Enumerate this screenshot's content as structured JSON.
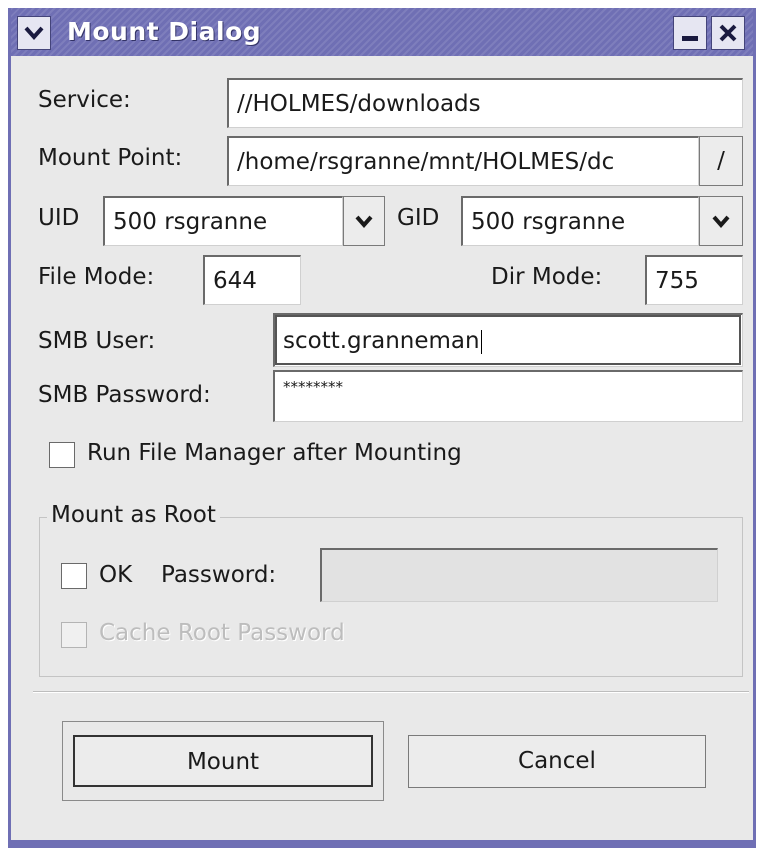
{
  "window": {
    "title": "Mount Dialog",
    "accent_color": "#6f6fb4",
    "menu_icon": "chevron-down-icon",
    "minimize_icon": "minimize-icon",
    "close_icon": "close-icon"
  },
  "service": {
    "label": "Service:",
    "value": "//HOLMES/downloads"
  },
  "mount_point": {
    "label": "Mount Point:",
    "value": "/home/rsgranne/mnt/HOLMES/dc",
    "browse_label": "/"
  },
  "uid": {
    "label": "UID",
    "value": "500 rsgranne"
  },
  "gid": {
    "label": "GID",
    "value": "500 rsgranne"
  },
  "file_mode": {
    "label": "File Mode:",
    "value": "644"
  },
  "dir_mode": {
    "label": "Dir Mode:",
    "value": "755"
  },
  "smb_user": {
    "label": "SMB User:",
    "value": "scott.granneman"
  },
  "smb_password": {
    "label": "SMB Password:",
    "value": "********"
  },
  "run_file_manager": {
    "label": "Run File Manager after Mounting",
    "checked": false
  },
  "root_group": {
    "title": "Mount as Root",
    "ok_label": "OK",
    "password_label": "Password:",
    "password_value": "",
    "cache_label": "Cache Root Password"
  },
  "buttons": {
    "mount": "Mount",
    "cancel": "Cancel"
  }
}
